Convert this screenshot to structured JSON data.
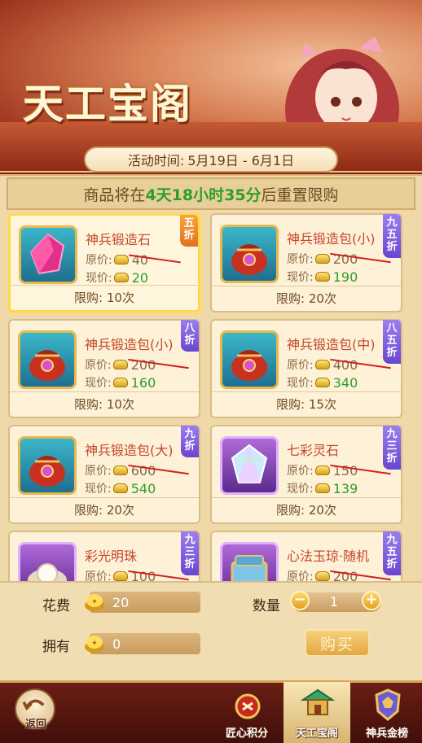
{
  "header": {
    "title": "天工宝阁",
    "time_label": "活动时间:",
    "time_range": "5月19日 - 6月1日"
  },
  "reset": {
    "prefix": "商品将在",
    "countdown": "4天18小时35分",
    "suffix": "后重置限购"
  },
  "labels": {
    "orig": "原价:",
    "cur": "现价:"
  },
  "items": [
    {
      "name": "神兵锻造石",
      "orig": "40",
      "cur": "20",
      "limit": "限购: 10次",
      "badge": "五折",
      "badge_color": "orange",
      "icon": "red-gem-icon",
      "selected": true
    },
    {
      "name": "神兵锻造包(小)",
      "orig": "200",
      "cur": "190",
      "limit": "限购: 20次",
      "badge": "九五折",
      "badge_color": "violet",
      "icon": "red-bag-icon"
    },
    {
      "name": "神兵锻造包(小)",
      "orig": "200",
      "cur": "160",
      "limit": "限购: 10次",
      "badge": "八折",
      "badge_color": "violet",
      "icon": "red-bag-icon"
    },
    {
      "name": "神兵锻造包(中)",
      "orig": "400",
      "cur": "340",
      "limit": "限购: 15次",
      "badge": "八五折",
      "badge_color": "violet",
      "icon": "red-bag-icon"
    },
    {
      "name": "神兵锻造包(大)",
      "orig": "600",
      "cur": "540",
      "limit": "限购: 20次",
      "badge": "九折",
      "badge_color": "violet",
      "icon": "red-bag-icon"
    },
    {
      "name": "七彩灵石",
      "orig": "150",
      "cur": "139",
      "limit": "限购: 20次",
      "badge": "九三折",
      "badge_color": "violet",
      "icon": "rainbow-crystal-icon"
    },
    {
      "name": "彩光明珠",
      "orig": "100",
      "cur": "",
      "limit": "",
      "badge": "九三折",
      "badge_color": "violet",
      "icon": "pearl-icon"
    },
    {
      "name": "心法玉琼·随机",
      "orig": "200",
      "cur": "",
      "limit": "",
      "badge": "九五折",
      "badge_color": "violet",
      "icon": "jade-box-icon"
    }
  ],
  "purchase": {
    "cost_label": "花费",
    "cost_value": "20",
    "own_label": "拥有",
    "own_value": "0",
    "qty_label": "数量",
    "qty_value": "1",
    "buy_label": "购买"
  },
  "nav": {
    "back": "返回",
    "tabs": [
      "匠心积分",
      "天工宝阁",
      "神兵金榜"
    ]
  }
}
